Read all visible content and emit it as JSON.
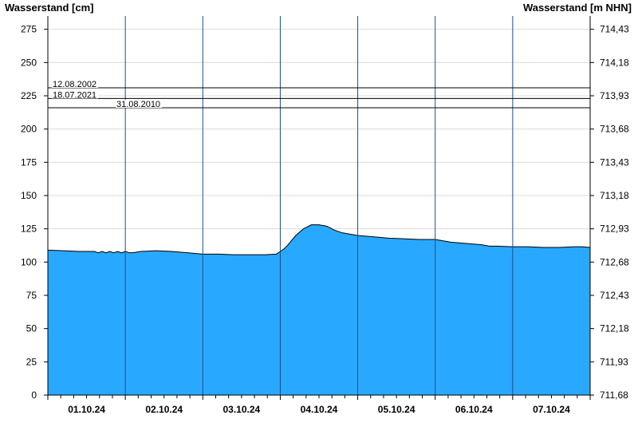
{
  "chart_data": {
    "type": "area",
    "ylabel_left": "Wasserstand [cm]",
    "ylabel_right": "Wasserstand [m NHN]",
    "ylim": [
      0,
      285
    ],
    "y_ticks_left": [
      0,
      25,
      50,
      75,
      100,
      125,
      150,
      175,
      200,
      225,
      250,
      275
    ],
    "y_ticks_right": [
      "711,68",
      "711,93",
      "712,18",
      "712,43",
      "712,68",
      "712,93",
      "713,18",
      "713,43",
      "713,68",
      "713,93",
      "714,18",
      "714,43"
    ],
    "xlim": [
      0,
      7
    ],
    "x_day_boundaries": [
      1,
      2,
      3,
      4,
      5,
      6
    ],
    "x_labels": [
      {
        "x": 0.5,
        "label": "01.10.24"
      },
      {
        "x": 1.5,
        "label": "02.10.24"
      },
      {
        "x": 2.5,
        "label": "03.10.24"
      },
      {
        "x": 3.5,
        "label": "04.10.24"
      },
      {
        "x": 4.5,
        "label": "05.10.24"
      },
      {
        "x": 5.5,
        "label": "06.10.24"
      },
      {
        "x": 6.5,
        "label": "07.10.24"
      }
    ],
    "reference_lines": [
      {
        "label": "12.08.2002",
        "value": 231
      },
      {
        "label": "18.07.2021",
        "value": 223
      },
      {
        "label": "31.08.2010",
        "value": 216
      }
    ],
    "series": [
      {
        "color": "#29a8ff",
        "x": [
          0,
          0.2,
          0.4,
          0.6,
          0.65,
          0.7,
          0.75,
          0.8,
          0.85,
          0.9,
          0.95,
          1.0,
          1.05,
          1.1,
          1.2,
          1.4,
          1.6,
          1.8,
          2.0,
          2.2,
          2.4,
          2.6,
          2.8,
          2.95,
          3.0,
          3.05,
          3.1,
          3.2,
          3.3,
          3.4,
          3.5,
          3.6,
          3.7,
          3.8,
          3.9,
          4.0,
          4.2,
          4.4,
          4.6,
          4.8,
          5.0,
          5.2,
          5.4,
          5.6,
          5.7,
          5.8,
          6.0,
          6.2,
          6.4,
          6.6,
          6.8,
          6.9,
          7.0
        ],
        "y": [
          109,
          108.5,
          108,
          108,
          107,
          108,
          107,
          108,
          107,
          108,
          107,
          108,
          107,
          107,
          108,
          108.5,
          108,
          107,
          106,
          106,
          105.5,
          105.5,
          105.5,
          106,
          108,
          110,
          113,
          120,
          125,
          128,
          128,
          127,
          124,
          122,
          121,
          120,
          119,
          118,
          117.5,
          117,
          117,
          115,
          114,
          113,
          112,
          112,
          111.5,
          111.5,
          111,
          111,
          111.5,
          111.5,
          111
        ]
      }
    ]
  }
}
